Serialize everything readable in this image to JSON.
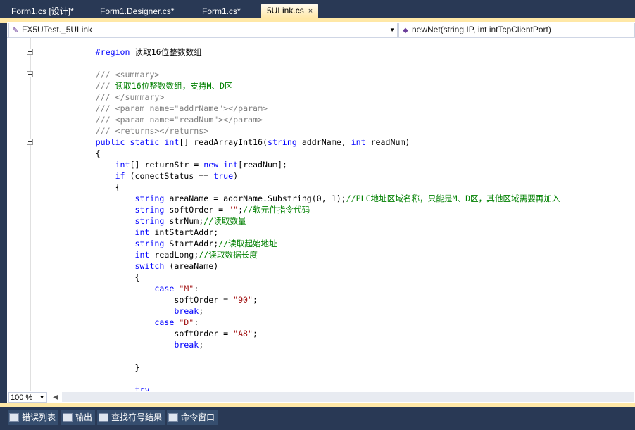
{
  "tabs": [
    {
      "label": "Form1.cs [设计]*",
      "active": false
    },
    {
      "label": "Form1.Designer.cs*",
      "active": false
    },
    {
      "label": "Form1.cs*",
      "active": false
    },
    {
      "label": "5ULink.cs",
      "active": true
    }
  ],
  "tab_close_icon": "×",
  "nav": {
    "class_combo": "FX5UTest._5ULink",
    "member_combo": "newNet(string IP, int intTcpClientPort)"
  },
  "code_lines": [
    [
      {
        "t": "        ",
        "c": "tx"
      },
      {
        "t": "#region",
        "c": "kw"
      },
      {
        "t": " 读取16位整数数组",
        "c": "tx"
      }
    ],
    [
      {
        "t": "",
        "c": "tx"
      }
    ],
    [
      {
        "t": "        ",
        "c": "tx"
      },
      {
        "t": "///",
        "c": "xd"
      },
      {
        "t": " ",
        "c": "cm"
      },
      {
        "t": "<summary>",
        "c": "xd"
      }
    ],
    [
      {
        "t": "        ",
        "c": "tx"
      },
      {
        "t": "///",
        "c": "xd"
      },
      {
        "t": " 读取16位整数数组，支持M、D区",
        "c": "cm"
      }
    ],
    [
      {
        "t": "        ",
        "c": "tx"
      },
      {
        "t": "///",
        "c": "xd"
      },
      {
        "t": " ",
        "c": "cm"
      },
      {
        "t": "</summary>",
        "c": "xd"
      }
    ],
    [
      {
        "t": "        ",
        "c": "tx"
      },
      {
        "t": "///",
        "c": "xd"
      },
      {
        "t": " ",
        "c": "cm"
      },
      {
        "t": "<param name=\"addrName\"></param>",
        "c": "xd"
      }
    ],
    [
      {
        "t": "        ",
        "c": "tx"
      },
      {
        "t": "///",
        "c": "xd"
      },
      {
        "t": " ",
        "c": "cm"
      },
      {
        "t": "<param name=\"readNum\"></param>",
        "c": "xd"
      }
    ],
    [
      {
        "t": "        ",
        "c": "tx"
      },
      {
        "t": "///",
        "c": "xd"
      },
      {
        "t": " ",
        "c": "cm"
      },
      {
        "t": "<returns></returns>",
        "c": "xd"
      }
    ],
    [
      {
        "t": "        ",
        "c": "tx"
      },
      {
        "t": "public static int",
        "c": "kw"
      },
      {
        "t": "[] readArrayInt16(",
        "c": "tx"
      },
      {
        "t": "string",
        "c": "kw"
      },
      {
        "t": " addrName, ",
        "c": "tx"
      },
      {
        "t": "int",
        "c": "kw"
      },
      {
        "t": " readNum)",
        "c": "tx"
      }
    ],
    [
      {
        "t": "        {",
        "c": "tx"
      }
    ],
    [
      {
        "t": "            ",
        "c": "tx"
      },
      {
        "t": "int",
        "c": "kw"
      },
      {
        "t": "[] returnStr = ",
        "c": "tx"
      },
      {
        "t": "new int",
        "c": "kw"
      },
      {
        "t": "[readNum];",
        "c": "tx"
      }
    ],
    [
      {
        "t": "            ",
        "c": "tx"
      },
      {
        "t": "if",
        "c": "kw"
      },
      {
        "t": " (conectStatus == ",
        "c": "tx"
      },
      {
        "t": "true",
        "c": "kw"
      },
      {
        "t": ")",
        "c": "tx"
      }
    ],
    [
      {
        "t": "            {",
        "c": "tx"
      }
    ],
    [
      {
        "t": "                ",
        "c": "tx"
      },
      {
        "t": "string",
        "c": "kw"
      },
      {
        "t": " areaName = addrName.Substring(0, 1);",
        "c": "tx"
      },
      {
        "t": "//PLC地址区域名称，只能是M、D区，其他区域需要再加入",
        "c": "cm"
      }
    ],
    [
      {
        "t": "                ",
        "c": "tx"
      },
      {
        "t": "string",
        "c": "kw"
      },
      {
        "t": " softOrder = ",
        "c": "tx"
      },
      {
        "t": "\"\"",
        "c": "st"
      },
      {
        "t": ";",
        "c": "tx"
      },
      {
        "t": "//软元件指令代码",
        "c": "cm"
      }
    ],
    [
      {
        "t": "                ",
        "c": "tx"
      },
      {
        "t": "string",
        "c": "kw"
      },
      {
        "t": " strNum;",
        "c": "tx"
      },
      {
        "t": "//读取数量",
        "c": "cm"
      }
    ],
    [
      {
        "t": "                ",
        "c": "tx"
      },
      {
        "t": "int",
        "c": "kw"
      },
      {
        "t": " intStartAddr;",
        "c": "tx"
      }
    ],
    [
      {
        "t": "                ",
        "c": "tx"
      },
      {
        "t": "string",
        "c": "kw"
      },
      {
        "t": " StartAddr;",
        "c": "tx"
      },
      {
        "t": "//读取起始地址",
        "c": "cm"
      }
    ],
    [
      {
        "t": "                ",
        "c": "tx"
      },
      {
        "t": "int",
        "c": "kw"
      },
      {
        "t": " readLong;",
        "c": "tx"
      },
      {
        "t": "//读取数据长度",
        "c": "cm"
      }
    ],
    [
      {
        "t": "                ",
        "c": "tx"
      },
      {
        "t": "switch",
        "c": "kw"
      },
      {
        "t": " (areaName)",
        "c": "tx"
      }
    ],
    [
      {
        "t": "                {",
        "c": "tx"
      }
    ],
    [
      {
        "t": "                    ",
        "c": "tx"
      },
      {
        "t": "case",
        "c": "kw"
      },
      {
        "t": " ",
        "c": "tx"
      },
      {
        "t": "\"M\"",
        "c": "st"
      },
      {
        "t": ":",
        "c": "tx"
      }
    ],
    [
      {
        "t": "                        softOrder = ",
        "c": "tx"
      },
      {
        "t": "\"90\"",
        "c": "st"
      },
      {
        "t": ";",
        "c": "tx"
      }
    ],
    [
      {
        "t": "                        ",
        "c": "tx"
      },
      {
        "t": "break",
        "c": "kw"
      },
      {
        "t": ";",
        "c": "tx"
      }
    ],
    [
      {
        "t": "                    ",
        "c": "tx"
      },
      {
        "t": "case",
        "c": "kw"
      },
      {
        "t": " ",
        "c": "tx"
      },
      {
        "t": "\"D\"",
        "c": "st"
      },
      {
        "t": ":",
        "c": "tx"
      }
    ],
    [
      {
        "t": "                        softOrder = ",
        "c": "tx"
      },
      {
        "t": "\"A8\"",
        "c": "st"
      },
      {
        "t": ";",
        "c": "tx"
      }
    ],
    [
      {
        "t": "                        ",
        "c": "tx"
      },
      {
        "t": "break",
        "c": "kw"
      },
      {
        "t": ";",
        "c": "tx"
      }
    ],
    [
      {
        "t": "",
        "c": "tx"
      }
    ],
    [
      {
        "t": "                }",
        "c": "tx"
      }
    ],
    [
      {
        "t": "",
        "c": "tx"
      }
    ],
    [
      {
        "t": "                ",
        "c": "tx"
      },
      {
        "t": "try",
        "c": "kw"
      }
    ]
  ],
  "zoom": "100 %",
  "bottom_tabs": [
    {
      "label": "错误列表",
      "icon": "error-list-icon"
    },
    {
      "label": "输出",
      "icon": "output-icon"
    },
    {
      "label": "查找符号结果",
      "icon": "find-symbol-icon"
    },
    {
      "label": "命令窗口",
      "icon": "command-window-icon"
    }
  ]
}
